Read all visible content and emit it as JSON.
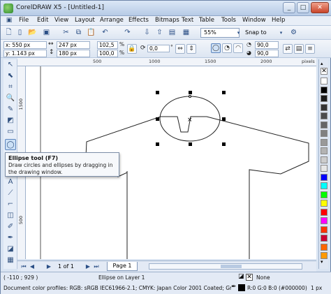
{
  "window": {
    "title": "CorelDRAW X5 - [Untitled-1]",
    "minimize": "_",
    "restore": "□",
    "close": "✕"
  },
  "menu": [
    "File",
    "Edit",
    "View",
    "Layout",
    "Arrange",
    "Effects",
    "Bitmaps",
    "Text",
    "Table",
    "Tools",
    "Window",
    "Help"
  ],
  "toolbar": {
    "zoom": "55%",
    "snap_to": "Snap to"
  },
  "properties": {
    "x": "x: 550 px",
    "y": "y: 1.143 px",
    "width": "247 px",
    "height": "180 px",
    "scale_x": "102,5",
    "scale_y": "100,0",
    "scale_unit_x": "%",
    "scale_unit_y": "%",
    "rotation": "0,0",
    "start_angle": "90,0",
    "end_angle": "90,0"
  },
  "ruler": {
    "unit": "pixels",
    "top_ticks": [
      "500",
      "1000",
      "1500",
      "2000"
    ],
    "left_ticks": [
      "1500",
      "1000",
      "500"
    ]
  },
  "tooltip": {
    "title": "Ellipse tool (F7)",
    "description": "Draw circles and ellipses by dragging in the drawing window."
  },
  "pagenav": {
    "page_count": "1 of 1",
    "page_tab": "Page 1"
  },
  "status": {
    "coords": "( -110 ; 929 )",
    "object": "Ellipse on Layer 1",
    "fill": "None",
    "profiles": "Document color profiles: RGB: sRGB IEC61966-2.1; CMYK: Japan Color 2001 Coated; Grayscale: D...",
    "outline_color": "R:0 G:0 B:0 (#000000)",
    "outline_width": "1 px"
  },
  "palette_colors": [
    "#ffffff",
    "#000000",
    "#1a1a1a",
    "#333333",
    "#4d4d4d",
    "#666666",
    "#808080",
    "#999999",
    "#b3b3b3",
    "#cccccc",
    "#e6e6e6",
    "#0000ff",
    "#00ffff",
    "#00ff00",
    "#ffff00",
    "#ff0000",
    "#ff00ff",
    "#ff3300",
    "#cc0033",
    "#ff6600",
    "#ff9900"
  ]
}
